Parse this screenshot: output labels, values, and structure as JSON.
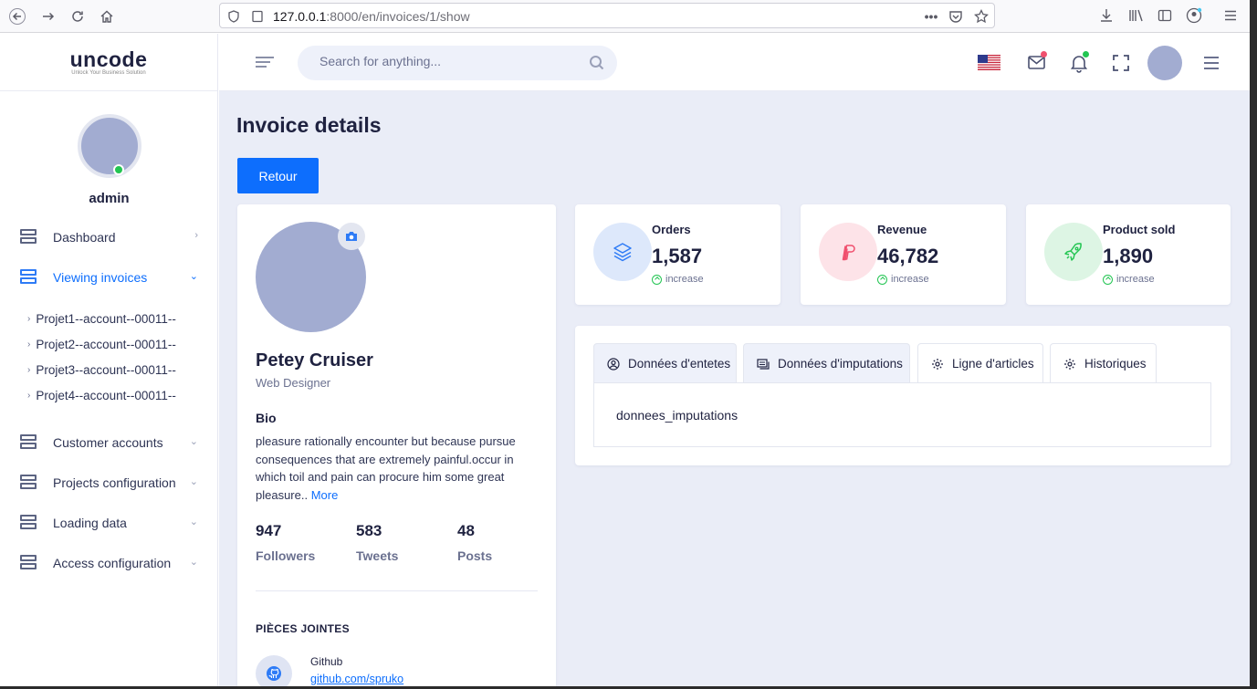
{
  "browser": {
    "url_host": "127.0.0.1",
    "url_path": ":8000/en/invoices/1/show"
  },
  "sidebar": {
    "logo": "uncode",
    "tagline": "Unlock Your Business Solution",
    "user": "admin",
    "menu": [
      {
        "label": "Dashboard",
        "active": false
      },
      {
        "label": "Viewing invoices",
        "active": true
      },
      {
        "label": "Customer accounts",
        "active": false
      },
      {
        "label": "Projects configuration",
        "active": false
      },
      {
        "label": "Loading data",
        "active": false
      },
      {
        "label": "Access configuration",
        "active": false
      }
    ],
    "sub_items": [
      "Projet1--account--00011--",
      "Projet2--account--00011--",
      "Projet3--account--00011--",
      "Projet4--account--00011--"
    ]
  },
  "header": {
    "search_placeholder": "Search for anything..."
  },
  "page": {
    "title": "Invoice details",
    "back_button": "Retour"
  },
  "profile": {
    "name": "Petey Cruiser",
    "role": "Web Designer",
    "bio_heading": "Bio",
    "bio": "pleasure rationally encounter but because pursue consequences that are extremely painful.occur in which toil and pain can procure him some great pleasure..",
    "bio_more": "More",
    "stats": [
      {
        "value": "947",
        "label": "Followers"
      },
      {
        "value": "583",
        "label": "Tweets"
      },
      {
        "value": "48",
        "label": "Posts"
      }
    ],
    "attachments_heading": "PIÈCES JOINTES",
    "attachment": {
      "name": "Github",
      "link": "github.com/spruko"
    }
  },
  "stat_cards": [
    {
      "title": "Orders",
      "value": "1,587",
      "note": "increase",
      "color": "#dde8fb",
      "icon_color": "#2e7bf6"
    },
    {
      "title": "Revenue",
      "value": "46,782",
      "note": "increase",
      "color": "#fde3e8",
      "icon_color": "#f0506e"
    },
    {
      "title": "Product sold",
      "value": "1,890",
      "note": "increase",
      "color": "#ddf5e4",
      "icon_color": "#23c552"
    }
  ],
  "tabs": [
    {
      "label": "Données d'entetes",
      "active": true
    },
    {
      "label": "Données d'imputations",
      "active": true
    },
    {
      "label": "Ligne d'articles",
      "active": false
    },
    {
      "label": "Historiques",
      "active": false
    }
  ],
  "tab_content": "donnees_imputations",
  "colors": {
    "accent": "#0d6efd",
    "online": "#23c552",
    "background": "#eaedf7"
  }
}
